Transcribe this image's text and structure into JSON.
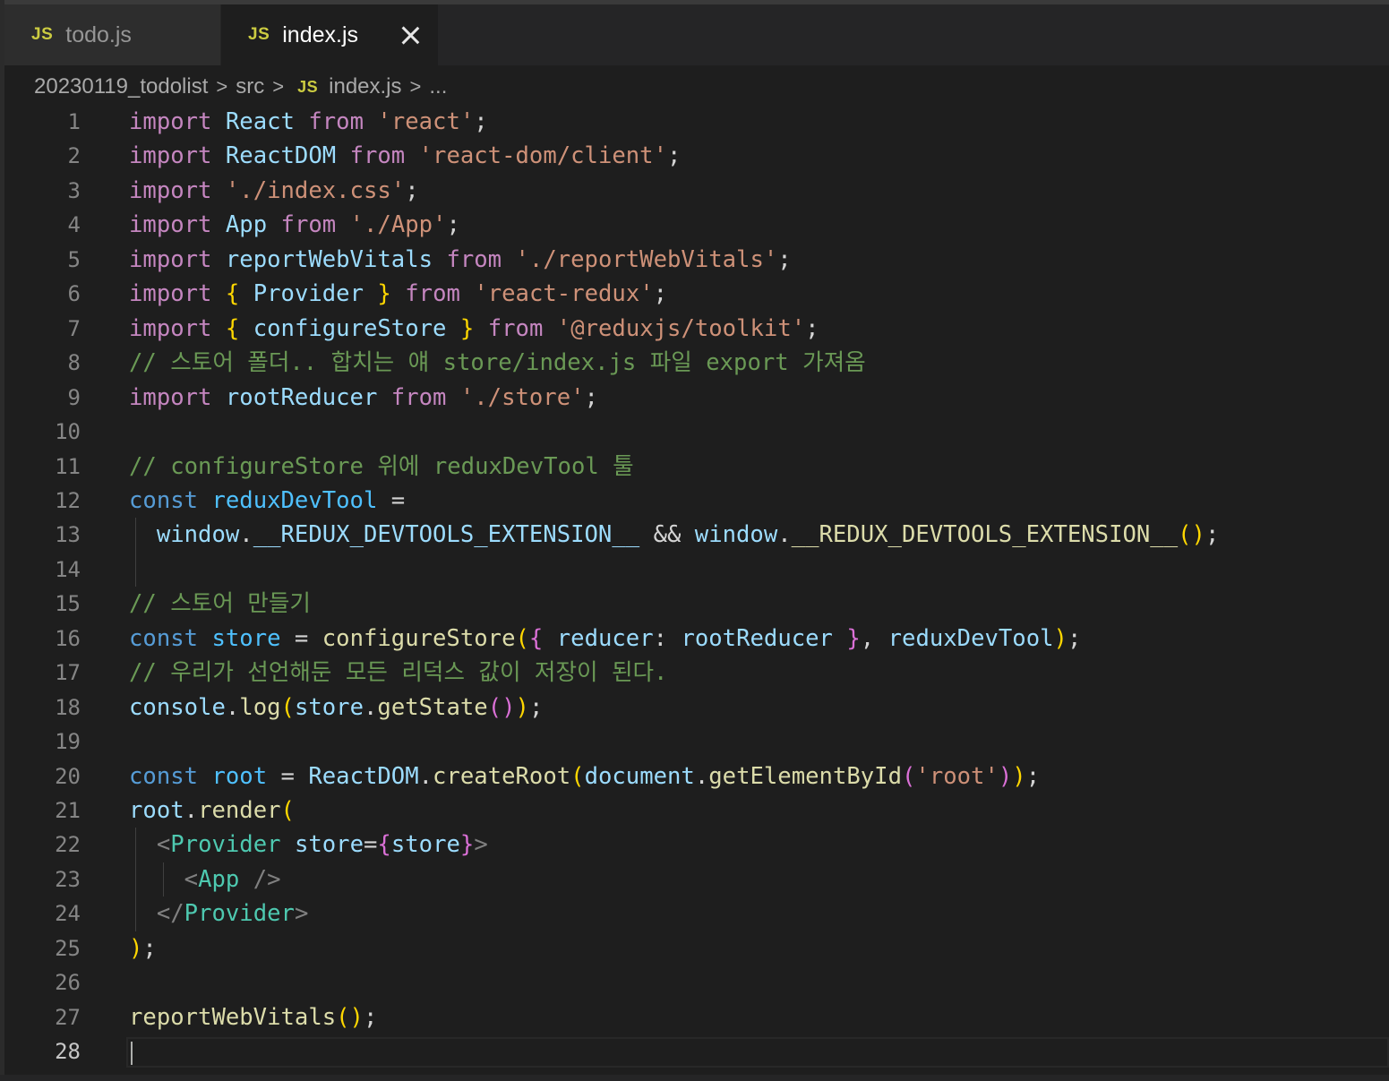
{
  "tabs": [
    {
      "icon": "JS",
      "label": "todo.js",
      "active": false
    },
    {
      "icon": "JS",
      "label": "index.js",
      "active": true
    }
  ],
  "breadcrumb": {
    "items": [
      "20230119_todolist",
      "src",
      "index.js",
      "..."
    ],
    "file_icon": "JS",
    "separator": ">"
  },
  "editor": {
    "language": "javascript",
    "current_line": 28,
    "line_count": 28,
    "lines": [
      [
        [
          "kw",
          "import"
        ],
        [
          "pl",
          " "
        ],
        [
          "va",
          "React"
        ],
        [
          "pl",
          " "
        ],
        [
          "kw",
          "from"
        ],
        [
          "pl",
          " "
        ],
        [
          "st",
          "'react'"
        ],
        [
          "pl",
          ";"
        ]
      ],
      [
        [
          "kw",
          "import"
        ],
        [
          "pl",
          " "
        ],
        [
          "va",
          "ReactDOM"
        ],
        [
          "pl",
          " "
        ],
        [
          "kw",
          "from"
        ],
        [
          "pl",
          " "
        ],
        [
          "st",
          "'react-dom/client'"
        ],
        [
          "pl",
          ";"
        ]
      ],
      [
        [
          "kw",
          "import"
        ],
        [
          "pl",
          " "
        ],
        [
          "st",
          "'./index.css'"
        ],
        [
          "pl",
          ";"
        ]
      ],
      [
        [
          "kw",
          "import"
        ],
        [
          "pl",
          " "
        ],
        [
          "va",
          "App"
        ],
        [
          "pl",
          " "
        ],
        [
          "kw",
          "from"
        ],
        [
          "pl",
          " "
        ],
        [
          "st",
          "'./App'"
        ],
        [
          "pl",
          ";"
        ]
      ],
      [
        [
          "kw",
          "import"
        ],
        [
          "pl",
          " "
        ],
        [
          "va",
          "reportWebVitals"
        ],
        [
          "pl",
          " "
        ],
        [
          "kw",
          "from"
        ],
        [
          "pl",
          " "
        ],
        [
          "st",
          "'./reportWebVitals'"
        ],
        [
          "pl",
          ";"
        ]
      ],
      [
        [
          "kw",
          "import"
        ],
        [
          "pl",
          " "
        ],
        [
          "b1",
          "{"
        ],
        [
          "pl",
          " "
        ],
        [
          "va",
          "Provider"
        ],
        [
          "pl",
          " "
        ],
        [
          "b1",
          "}"
        ],
        [
          "pl",
          " "
        ],
        [
          "kw",
          "from"
        ],
        [
          "pl",
          " "
        ],
        [
          "st",
          "'react-redux'"
        ],
        [
          "pl",
          ";"
        ]
      ],
      [
        [
          "kw",
          "import"
        ],
        [
          "pl",
          " "
        ],
        [
          "b1",
          "{"
        ],
        [
          "pl",
          " "
        ],
        [
          "va",
          "configureStore"
        ],
        [
          "pl",
          " "
        ],
        [
          "b1",
          "}"
        ],
        [
          "pl",
          " "
        ],
        [
          "kw",
          "from"
        ],
        [
          "pl",
          " "
        ],
        [
          "st",
          "'@reduxjs/toolkit'"
        ],
        [
          "pl",
          ";"
        ]
      ],
      [
        [
          "cm",
          "// 스토어 폴더.. 합치는 얘 store/index.js 파일 export 가져옴"
        ]
      ],
      [
        [
          "kw",
          "import"
        ],
        [
          "pl",
          " "
        ],
        [
          "va",
          "rootReducer"
        ],
        [
          "pl",
          " "
        ],
        [
          "kw",
          "from"
        ],
        [
          "pl",
          " "
        ],
        [
          "st",
          "'./store'"
        ],
        [
          "pl",
          ";"
        ]
      ],
      [],
      [
        [
          "cm",
          "// configureStore 위에 reduxDevTool 툴"
        ]
      ],
      [
        [
          "kd",
          "const"
        ],
        [
          "pl",
          " "
        ],
        [
          "cv",
          "reduxDevTool"
        ],
        [
          "pl",
          " ="
        ]
      ],
      [
        [
          "pl",
          "  "
        ],
        [
          "va",
          "window"
        ],
        [
          "pl",
          "."
        ],
        [
          "va",
          "__REDUX_DEVTOOLS_EXTENSION__"
        ],
        [
          "pl",
          " && "
        ],
        [
          "va",
          "window"
        ],
        [
          "pl",
          "."
        ],
        [
          "fn",
          "__REDUX_DEVTOOLS_EXTENSION__"
        ],
        [
          "b1",
          "()"
        ],
        [
          "pl",
          ";"
        ]
      ],
      [],
      [
        [
          "cm",
          "// 스토어 만들기"
        ]
      ],
      [
        [
          "kd",
          "const"
        ],
        [
          "pl",
          " "
        ],
        [
          "cv",
          "store"
        ],
        [
          "pl",
          " = "
        ],
        [
          "fn",
          "configureStore"
        ],
        [
          "b1",
          "("
        ],
        [
          "b2",
          "{"
        ],
        [
          "pl",
          " "
        ],
        [
          "va",
          "reducer"
        ],
        [
          "pl",
          ": "
        ],
        [
          "va",
          "rootReducer"
        ],
        [
          "pl",
          " "
        ],
        [
          "b2",
          "}"
        ],
        [
          "pl",
          ", "
        ],
        [
          "va",
          "reduxDevTool"
        ],
        [
          "b1",
          ")"
        ],
        [
          "pl",
          ";"
        ]
      ],
      [
        [
          "cm",
          "// 우리가 선언해둔 모든 리덕스 값이 저장이 된다."
        ]
      ],
      [
        [
          "va",
          "console"
        ],
        [
          "pl",
          "."
        ],
        [
          "fn",
          "log"
        ],
        [
          "b1",
          "("
        ],
        [
          "va",
          "store"
        ],
        [
          "pl",
          "."
        ],
        [
          "fn",
          "getState"
        ],
        [
          "b2",
          "()"
        ],
        [
          "b1",
          ")"
        ],
        [
          "pl",
          ";"
        ]
      ],
      [],
      [
        [
          "kd",
          "const"
        ],
        [
          "pl",
          " "
        ],
        [
          "cv",
          "root"
        ],
        [
          "pl",
          " = "
        ],
        [
          "va",
          "ReactDOM"
        ],
        [
          "pl",
          "."
        ],
        [
          "fn",
          "createRoot"
        ],
        [
          "b1",
          "("
        ],
        [
          "va",
          "document"
        ],
        [
          "pl",
          "."
        ],
        [
          "fn",
          "getElementById"
        ],
        [
          "b2",
          "("
        ],
        [
          "st",
          "'root'"
        ],
        [
          "b2",
          ")"
        ],
        [
          "b1",
          ")"
        ],
        [
          "pl",
          ";"
        ]
      ],
      [
        [
          "va",
          "root"
        ],
        [
          "pl",
          "."
        ],
        [
          "fn",
          "render"
        ],
        [
          "b1",
          "("
        ]
      ],
      [
        [
          "pl",
          "  "
        ],
        [
          "tg",
          "<"
        ],
        [
          "ty",
          "Provider"
        ],
        [
          "pl",
          " "
        ],
        [
          "va",
          "store"
        ],
        [
          "pl",
          "="
        ],
        [
          "b2",
          "{"
        ],
        [
          "va",
          "store"
        ],
        [
          "b2",
          "}"
        ],
        [
          "tg",
          ">"
        ]
      ],
      [
        [
          "pl",
          "    "
        ],
        [
          "tg",
          "<"
        ],
        [
          "ty",
          "App"
        ],
        [
          "pl",
          " "
        ],
        [
          "tg",
          "/>"
        ]
      ],
      [
        [
          "pl",
          "  "
        ],
        [
          "tg",
          "</"
        ],
        [
          "ty",
          "Provider"
        ],
        [
          "tg",
          ">"
        ]
      ],
      [
        [
          "b1",
          ")"
        ],
        [
          "pl",
          ";"
        ]
      ],
      [],
      [
        [
          "fn",
          "reportWebVitals"
        ],
        [
          "b1",
          "()"
        ],
        [
          "pl",
          ";"
        ]
      ],
      []
    ]
  }
}
